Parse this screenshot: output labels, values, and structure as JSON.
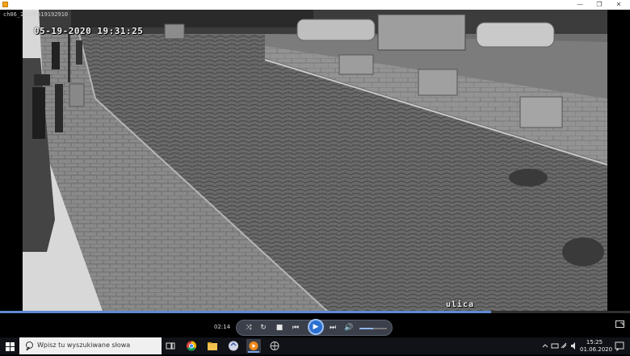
{
  "window": {
    "title": "",
    "minimize_glyph": "—",
    "maximize_glyph": "❐",
    "close_glyph": "✕"
  },
  "file_label": "ch06_20200519192910",
  "video": {
    "timestamp": "05-19-2020 19:31:25",
    "camera_label": "ulica"
  },
  "player": {
    "current_time": "02:14",
    "progress_fraction": 0.78,
    "volume_fraction": 0.5,
    "buttons": {
      "shuffle": "⤨",
      "repeat": "↻",
      "stop": "■",
      "previous": "⏮",
      "play": "▶",
      "next": "⏭",
      "volume": "🔊"
    }
  },
  "taskbar": {
    "search_placeholder": "Wpisz tu wyszukiwane słowa",
    "clock_time": "15:25",
    "clock_date": "01.06.2020",
    "pinned_apps": [
      "task-view-icon",
      "chrome-icon",
      "file-explorer-icon",
      "media-app-icon",
      "windows-media-player-icon",
      "network-app-icon"
    ],
    "tray": [
      "chevron-up-icon",
      "battery-icon",
      "network-icon",
      "volume-icon",
      "notifications-icon"
    ]
  },
  "colors": {
    "taskbar_bg": "#101218",
    "seek_fill": "#5f8ad6",
    "play_button": "#2b6fd1"
  }
}
